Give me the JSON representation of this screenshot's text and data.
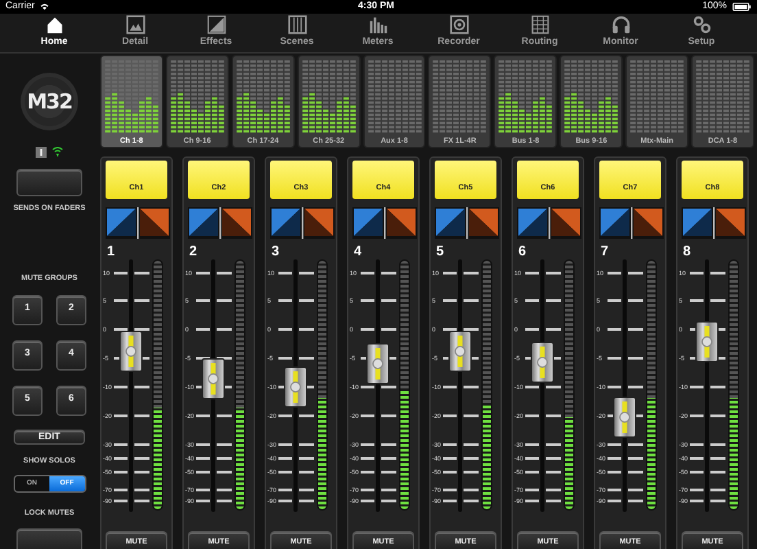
{
  "status_bar": {
    "carrier": "Carrier",
    "time": "4:30 PM",
    "battery": "100%"
  },
  "tabs": [
    {
      "label": "Home",
      "selected": true
    },
    {
      "label": "Detail",
      "selected": false
    },
    {
      "label": "Effects",
      "selected": false
    },
    {
      "label": "Scenes",
      "selected": false
    },
    {
      "label": "Meters",
      "selected": false
    },
    {
      "label": "Recorder",
      "selected": false
    },
    {
      "label": "Routing",
      "selected": false
    },
    {
      "label": "Monitor",
      "selected": false
    },
    {
      "label": "Setup",
      "selected": false
    }
  ],
  "logo": "M32",
  "sidebar": {
    "sends_label": "SENDS ON FADERS",
    "mute_groups_label": "MUTE GROUPS",
    "mute_groups": [
      "1",
      "2",
      "3",
      "4",
      "5",
      "6"
    ],
    "edit": "EDIT",
    "show_solos": {
      "label": "SHOW SOLOS",
      "options": [
        {
          "label": "ON",
          "selected": false
        },
        {
          "label": "OFF",
          "selected": true
        }
      ]
    },
    "lock_mutes_label": "LOCK MUTES"
  },
  "meter_banks": [
    {
      "label": "Ch 1-8",
      "selected": true,
      "active": true
    },
    {
      "label": "Ch 9-16",
      "selected": false,
      "active": true
    },
    {
      "label": "Ch 17-24",
      "selected": false,
      "active": true
    },
    {
      "label": "Ch 25-32",
      "selected": false,
      "active": true
    },
    {
      "label": "Aux 1-8",
      "selected": false,
      "active": false
    },
    {
      "label": "FX 1L-4R",
      "selected": false,
      "active": false
    },
    {
      "label": "Bus 1-8",
      "selected": false,
      "active": true
    },
    {
      "label": "Bus 9-16",
      "selected": false,
      "active": true
    },
    {
      "label": "Mtx-Main",
      "selected": false,
      "active": false
    },
    {
      "label": "DCA 1-8",
      "selected": false,
      "active": false
    }
  ],
  "channels": [
    {
      "label": "Ch1",
      "number": "1",
      "fader": {
        "level": 0.63
      },
      "meter": {
        "level": 0.41
      },
      "mute": "MUTE",
      "scale": [
        "10",
        "5",
        "0",
        "-5",
        "-10",
        "-20",
        "-30",
        "-40",
        "-50",
        "-70",
        "-90"
      ]
    },
    {
      "label": "Ch2",
      "number": "2",
      "fader": {
        "level": 0.52
      },
      "meter": {
        "level": 0.41
      },
      "mute": "MUTE",
      "scale": [
        "10",
        "5",
        "0",
        "-5",
        "-10",
        "-20",
        "-30",
        "-40",
        "-50",
        "-70",
        "-90"
      ]
    },
    {
      "label": "Ch3",
      "number": "3",
      "fader": {
        "level": 0.49
      },
      "meter": {
        "level": 0.45
      },
      "mute": "MUTE",
      "scale": [
        "10",
        "5",
        "0",
        "-5",
        "-10",
        "-20",
        "-30",
        "-40",
        "-50",
        "-70",
        "-90"
      ]
    },
    {
      "label": "Ch4",
      "number": "4",
      "fader": {
        "level": 0.58
      },
      "meter": {
        "level": 0.48
      },
      "mute": "MUTE",
      "scale": [
        "10",
        "5",
        "0",
        "-5",
        "-10",
        "-20",
        "-30",
        "-40",
        "-50",
        "-70",
        "-90"
      ]
    },
    {
      "label": "Ch5",
      "number": "5",
      "fader": {
        "level": 0.63
      },
      "meter": {
        "level": 0.42
      },
      "mute": "MUTE",
      "scale": [
        "10",
        "5",
        "0",
        "-5",
        "-10",
        "-20",
        "-30",
        "-40",
        "-50",
        "-70",
        "-90"
      ]
    },
    {
      "label": "Ch6",
      "number": "6",
      "fader": {
        "level": 0.59
      },
      "meter": {
        "level": 0.37
      },
      "mute": "MUTE",
      "scale": [
        "10",
        "5",
        "0",
        "-5",
        "-10",
        "-20",
        "-30",
        "-40",
        "-50",
        "-70",
        "-90"
      ]
    },
    {
      "label": "Ch7",
      "number": "7",
      "fader": {
        "level": 0.37
      },
      "meter": {
        "level": 0.45
      },
      "mute": "MUTE",
      "scale": [
        "10",
        "5",
        "0",
        "-5",
        "-10",
        "-20",
        "-30",
        "-40",
        "-50",
        "-70",
        "-90"
      ]
    },
    {
      "label": "Ch8",
      "number": "8",
      "fader": {
        "level": 0.67
      },
      "meter": {
        "level": 0.45
      },
      "mute": "MUTE",
      "scale": [
        "10",
        "5",
        "0",
        "-5",
        "-10",
        "-20",
        "-30",
        "-40",
        "-50",
        "-70",
        "-90"
      ]
    }
  ]
}
